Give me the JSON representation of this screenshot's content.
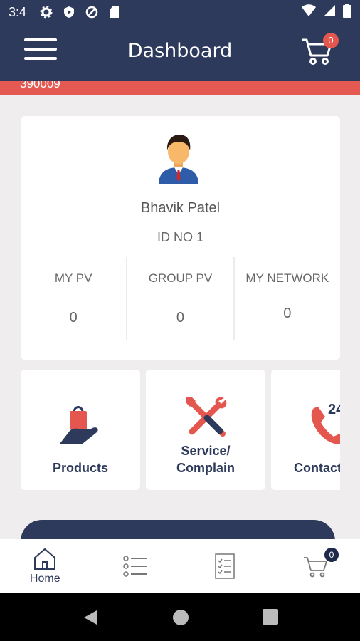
{
  "status_bar": {
    "time": "3:4"
  },
  "header": {
    "title": "Dashboard",
    "cart_count": "0"
  },
  "marquee": {
    "text": "390009"
  },
  "profile": {
    "name": "Bhavik Patel",
    "id": "ID NO 1",
    "stats": [
      {
        "label": "MY PV",
        "value": "0"
      },
      {
        "label": "GROUP PV",
        "value": "0"
      },
      {
        "label": "MY NETWORK",
        "value": "0"
      }
    ]
  },
  "tiles": [
    {
      "label": "Products",
      "icon": "hand-bag-icon"
    },
    {
      "label_line1": "Service/",
      "label_line2": "Complain",
      "icon": "tools-icon"
    },
    {
      "label": "Contact",
      "icon": "phone-24-icon"
    }
  ],
  "bottom_nav": {
    "home_label": "Home",
    "cart_count": "0"
  },
  "colors": {
    "primary": "#2e3a5c",
    "accent": "#e4574e",
    "background": "#efeded"
  }
}
